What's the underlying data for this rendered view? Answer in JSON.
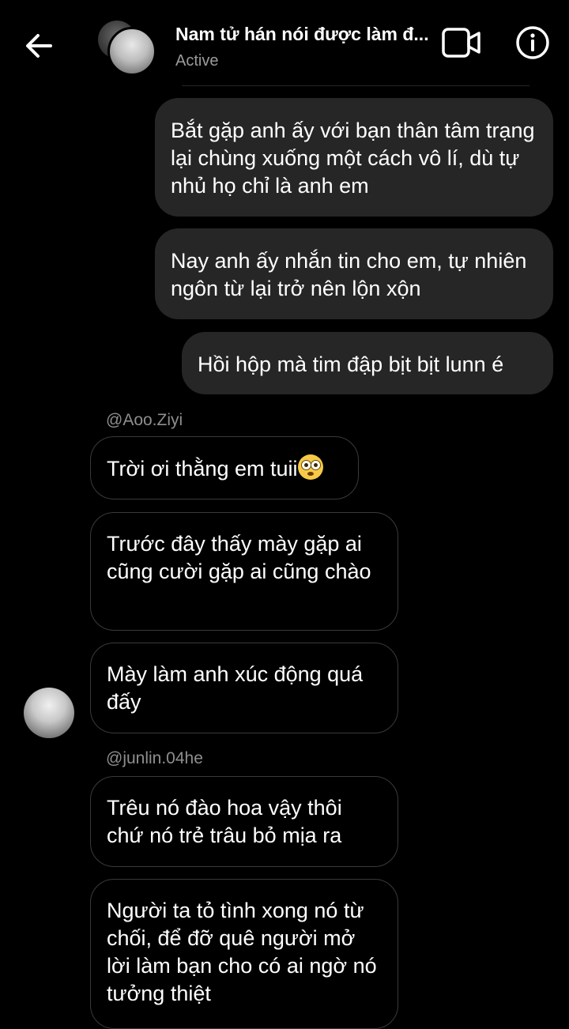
{
  "header": {
    "title": "Nam tử hán nói được làm đ...",
    "status": "Active"
  },
  "messages": {
    "sent": [
      "Bắt gặp anh ấy với bạn thân tâm trạng lại chùng xuống một cách vô lí, dù tự nhủ họ chỉ là anh em",
      "Nay anh ấy nhắn tin cho em, tự nhiên ngôn từ lại trở nên lộn xộn",
      "Hồi hộp mà tim đập bịt bịt lunn é"
    ],
    "handle_1": "@Aoo.Ziyi",
    "recv_1": "Trời ơi thằng em tuii",
    "recv_1_emoji": "flushed-face-emoji",
    "recv_2": "Trước đây thấy mày gặp ai cũng cười gặp ai cũng chào",
    "recv_3": "Mày làm anh xúc động quá đấy",
    "handle_2": "@junlin.04he",
    "recv_4": "Trêu nó đào hoa vậy thôi chứ nó trẻ trâu bỏ mịa ra",
    "recv_5": "Người ta tỏ tình xong nó từ chối, để đỡ quê người mở lời làm bạn cho có ai ngờ nó tưởng thiệt"
  },
  "colors": {
    "background": "#000000",
    "sent_bubble": "#262626",
    "received_border": "#3a3a3a",
    "secondary_text": "#8e8e8e"
  }
}
